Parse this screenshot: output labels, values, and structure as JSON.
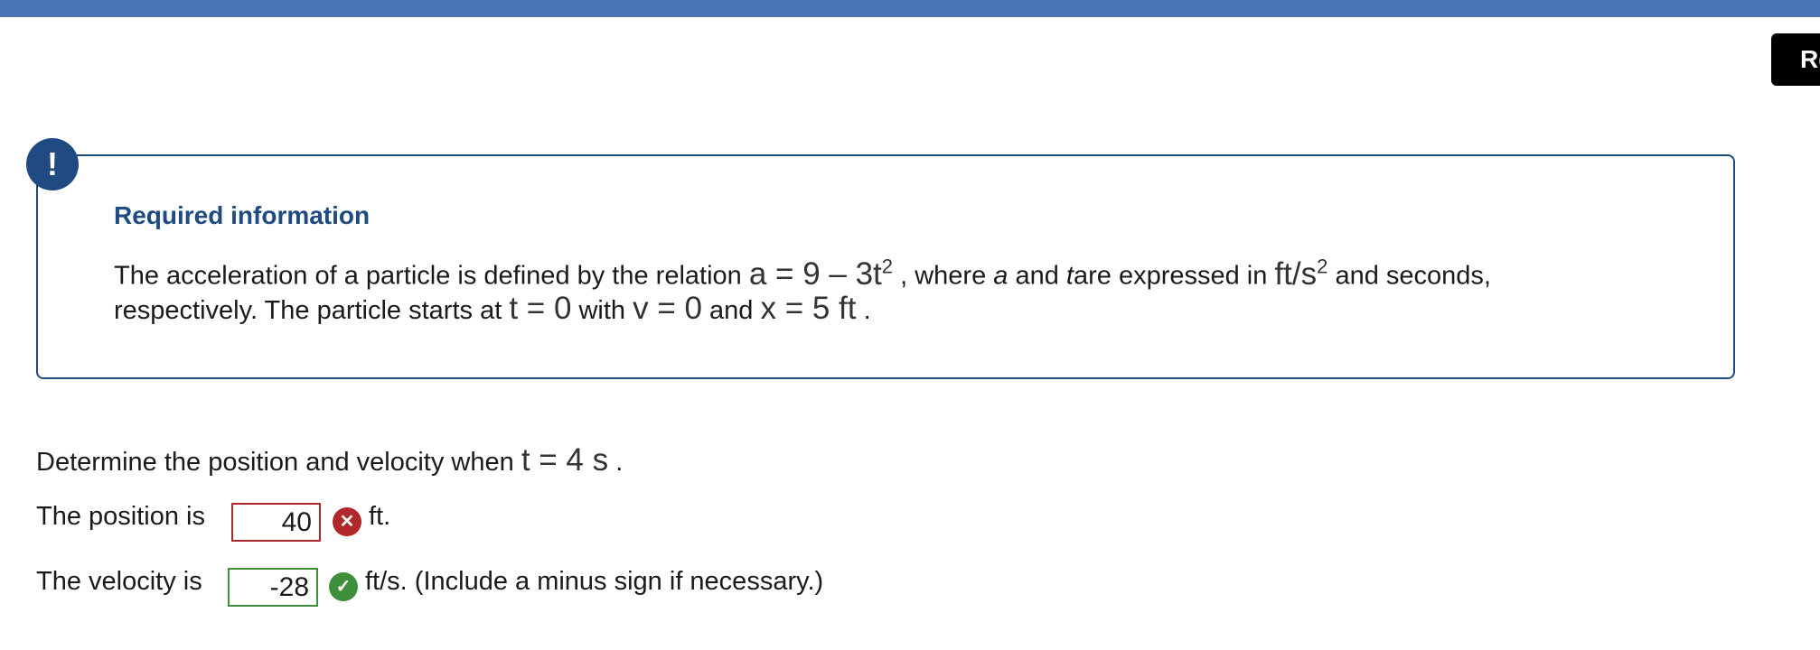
{
  "header": {
    "corner_button_label": "Re"
  },
  "info": {
    "alert_symbol": "!",
    "title": "Required information",
    "line1_before": "The acceleration of a particle is defined by the relation",
    "eq_a_base": "a = 9 – 3t",
    "eq_a_exp": "2",
    "line1_where": ", where",
    "var_a": "a",
    "and1": "and",
    "var_t": "t",
    "expressed": "are expressed in",
    "unit_base": "ft/s",
    "unit_exp": "2",
    "line1_end": "and seconds,",
    "line2_start": "respectively. The particle starts at",
    "eq_t0": "t = 0",
    "with": "with",
    "eq_v0": "v = 0",
    "and2": "and",
    "eq_x0": "x = 5 ft",
    "period": "."
  },
  "question": {
    "prompt": "Determine the position and velocity when",
    "eq_t4": "t = 4 s",
    "period": ".",
    "position": {
      "label": "The position is",
      "value": "40",
      "status": "incorrect",
      "status_icon": "x-circle-icon",
      "unit": "ft."
    },
    "velocity": {
      "label": "The velocity is",
      "value": "-28",
      "status": "correct",
      "status_icon": "check-circle-icon",
      "unit": "ft/s. (Include a minus sign if necessary.)"
    }
  },
  "colors": {
    "top_bar": "#4a76b5",
    "info_accent": "#1f4a82",
    "incorrect": "#b0282a",
    "correct": "#3e8e3b"
  }
}
